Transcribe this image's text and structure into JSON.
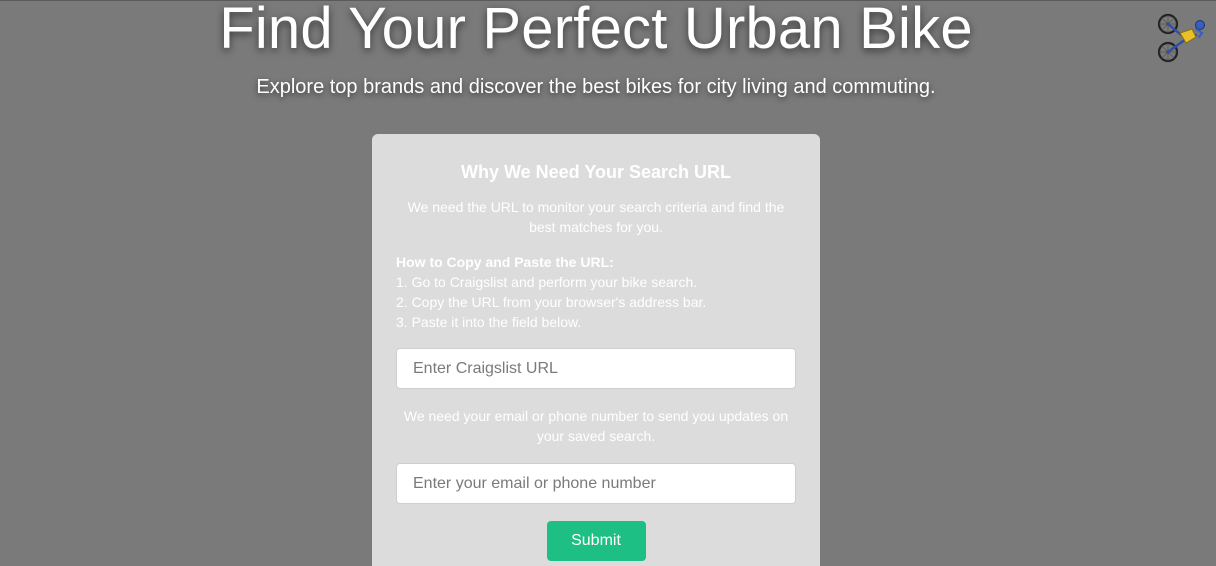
{
  "hero": {
    "title": "Find Your Perfect Urban Bike",
    "subtitle": "Explore top brands and discover the best bikes for city living and commuting."
  },
  "logo": {
    "icon": "recumbent-bike-icon"
  },
  "form_card": {
    "title": "Why We Need Your Search URL",
    "intro": "We need the URL to monitor your search criteria and find the best matches for you.",
    "howto_heading": "How to Copy and Paste the URL:",
    "steps": [
      "1. Go to Craigslist and perform your bike search.",
      "2. Copy the URL from your browser's address bar.",
      "3. Paste it into the field below."
    ],
    "url_input": {
      "value": "",
      "placeholder": "Enter Craigslist URL"
    },
    "contact_note": "We need your email or phone number to send you updates on your saved search.",
    "contact_input": {
      "value": "",
      "placeholder": "Enter your email or phone number"
    },
    "submit_label": "Submit"
  },
  "colors": {
    "background": "#7a7a7a",
    "card": "#dcdcdc",
    "accent": "#1dbf84"
  }
}
